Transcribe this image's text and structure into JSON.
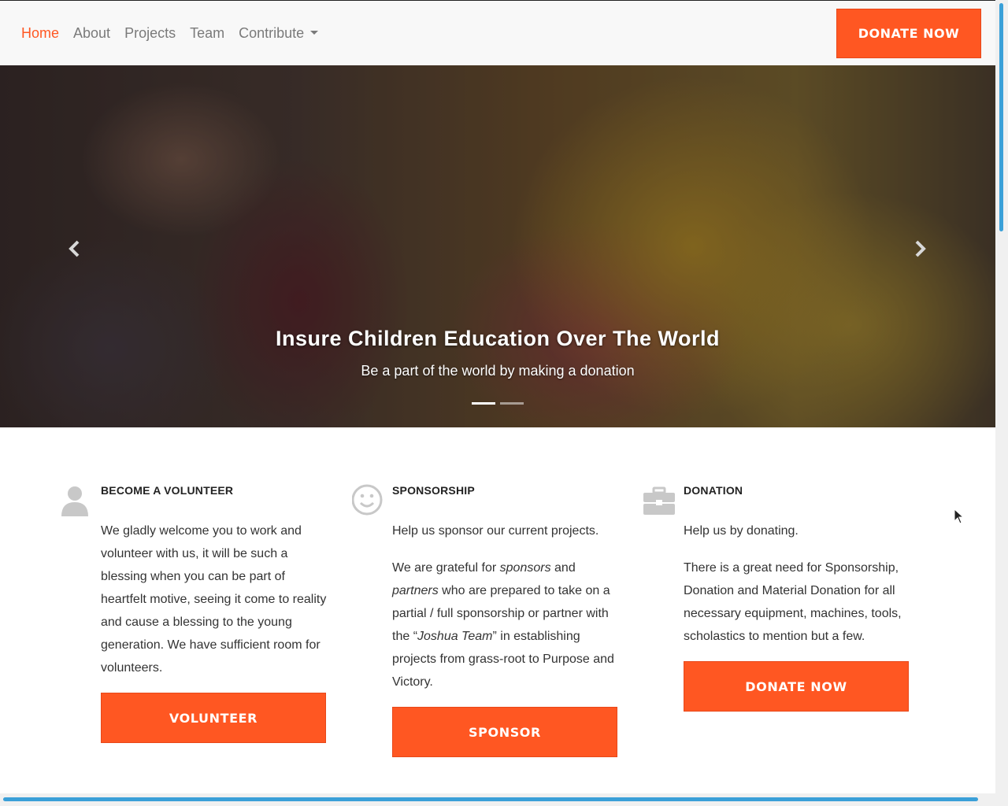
{
  "nav": {
    "links": [
      "Home",
      "About",
      "Projects",
      "Team",
      "Contribute"
    ],
    "donate_label": "DONATE NOW"
  },
  "hero": {
    "title": "Insure Children Education Over The World",
    "subtitle": "Be a part of the world by making a donation",
    "slide_count": 2,
    "active_slide": 1
  },
  "features": [
    {
      "icon": "user-icon",
      "title": "BECOME A VOLUNTEER",
      "paragraphs": [
        "We gladly welcome you to work and volunteer with us, it will be such a blessing when you can be part of heartfelt motive, seeing it come to reality and cause a blessing to the young generation. We have sufficient room for volunteers."
      ],
      "button": "VOLUNTEER"
    },
    {
      "icon": "smile-icon",
      "title": "SPONSORSHIP",
      "paragraphs": [
        "Help us sponsor our current projects."
      ],
      "para2": {
        "p1": "We are grateful for ",
        "em1": "sponsors",
        "p2": " and ",
        "em2": "partners",
        "p3": " who are prepared to take on a partial / full sponsorship or partner with the “",
        "em3": "Joshua Team",
        "p4": "” in establishing projects from grass-root to Purpose and Victory."
      },
      "button": "SPONSOR"
    },
    {
      "icon": "briefcase-icon",
      "title": "DONATION",
      "paragraphs": [
        "Help us by donating.",
        "There is a great need for Sponsorship, Donation and Material Donation for all necessary equipment, machines, tools, scholastics to mention but a few."
      ],
      "button": "DONATE NOW"
    }
  ],
  "colors": {
    "accent": "#ff5722",
    "nav_text": "#7a7a7a",
    "icon_gray": "#c8c8c8",
    "scrollbar": "#3aa0d8"
  }
}
